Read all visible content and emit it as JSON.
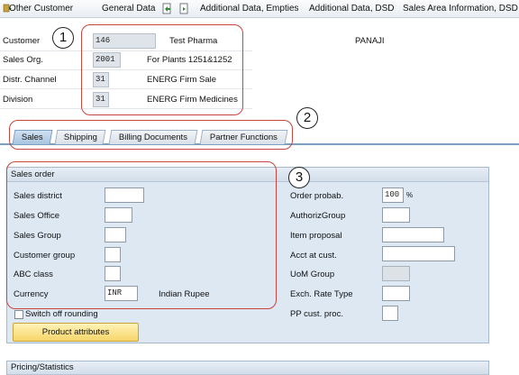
{
  "toolbar": {
    "items": [
      "Other Customer",
      "General Data",
      "Additional Data, Empties",
      "Additional Data, DSD",
      "Sales Area Information, DSD"
    ]
  },
  "header": {
    "customer_label": "Customer",
    "customer_value": "146",
    "customer_name": "Test Pharma",
    "customer_city": "PANAJI",
    "sales_org_label": "Sales Org.",
    "sales_org_value": "2001",
    "sales_org_desc": "For Plants 1251&1252",
    "distr_channel_label": "Distr. Channel",
    "distr_channel_value": "31",
    "distr_channel_desc": "ENERG Firm Sale",
    "division_label": "Division",
    "division_value": "31",
    "division_desc": "ENERG Firm Medicines"
  },
  "tabs": [
    "Sales",
    "Shipping",
    "Billing Documents",
    "Partner Functions"
  ],
  "active_tab": "Sales",
  "sales_order": {
    "title": "Sales order",
    "left_fields": [
      {
        "label": "Sales district",
        "value": ""
      },
      {
        "label": "Sales Office",
        "value": ""
      },
      {
        "label": "Sales Group",
        "value": ""
      },
      {
        "label": "Customer group",
        "value": ""
      },
      {
        "label": "ABC class",
        "value": ""
      },
      {
        "label": "Currency",
        "value": "INR",
        "desc": "Indian Rupee"
      }
    ],
    "right_fields": [
      {
        "label": "Order probab.",
        "value": "100",
        "unit": "%"
      },
      {
        "label": "AuthorizGroup",
        "value": ""
      },
      {
        "label": "Item proposal",
        "value": ""
      },
      {
        "label": "Acct at cust.",
        "value": ""
      },
      {
        "label": "UoM Group",
        "value": ""
      },
      {
        "label": "Exch. Rate Type",
        "value": ""
      },
      {
        "label": "PP cust. proc.",
        "value": ""
      }
    ],
    "switch_off_rounding": "Switch off rounding",
    "product_attributes_button": "Product attributes"
  },
  "pricing": {
    "title": "Pricing/Statistics"
  },
  "callouts": [
    "1",
    "2",
    "3"
  ],
  "colors": {
    "callout": "#c8453f",
    "tab_active": "#a9c4df",
    "group_bg": "#dde8f3",
    "button": "#f7d66a"
  }
}
